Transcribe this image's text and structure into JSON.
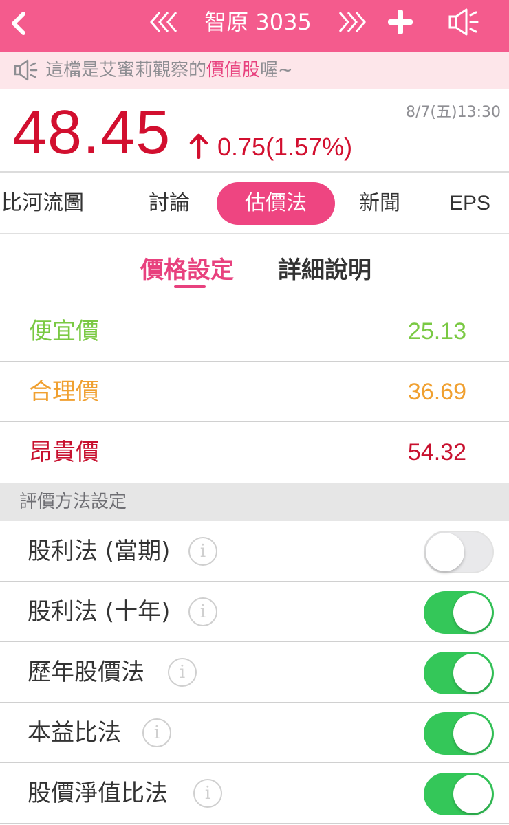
{
  "header": {
    "title": "智原 3035",
    "back_icon": "chevron-left-icon",
    "prev_icon": "double-chevron-left-icon",
    "next_icon": "double-chevron-right-icon",
    "add_icon": "plus-icon",
    "speaker_icon": "megaphone-icon",
    "background": "#f45b8d"
  },
  "announcement": {
    "icon": "megaphone-icon",
    "text_before": "這檔是艾蜜莉觀察的",
    "highlight": "價值股",
    "text_after": "喔~"
  },
  "quote": {
    "price": "48.45",
    "direction": "up",
    "change": "0.75(1.57%)",
    "time": "8/7(五)13:30",
    "color": "#d20f2f"
  },
  "tabs": [
    {
      "label": "比河流圖",
      "active": false
    },
    {
      "label": "討論",
      "active": false
    },
    {
      "label": "估價法",
      "active": true
    },
    {
      "label": "新聞",
      "active": false
    },
    {
      "label": "EPS",
      "active": false
    }
  ],
  "subtabs": [
    {
      "label": "價格設定",
      "active": true
    },
    {
      "label": "詳細說明",
      "active": false
    }
  ],
  "prices": [
    {
      "label": "便宜價",
      "value": "25.13",
      "color": "#7ac943"
    },
    {
      "label": "合理價",
      "value": "36.69",
      "color": "#f0a030"
    },
    {
      "label": "昂貴價",
      "value": "54.32",
      "color": "#c8102e"
    }
  ],
  "methods_section": {
    "title": "評價方法設定"
  },
  "methods": [
    {
      "label": "股利法 (當期)",
      "info_icon": "info-icon",
      "enabled": false
    },
    {
      "label": "股利法 (十年)",
      "info_icon": "info-icon",
      "enabled": true
    },
    {
      "label": "歷年股價法",
      "info_icon": "info-icon",
      "enabled": true
    },
    {
      "label": "本益比法",
      "info_icon": "info-icon",
      "enabled": true
    },
    {
      "label": "股價淨值比法",
      "info_icon": "info-icon",
      "enabled": true
    }
  ]
}
